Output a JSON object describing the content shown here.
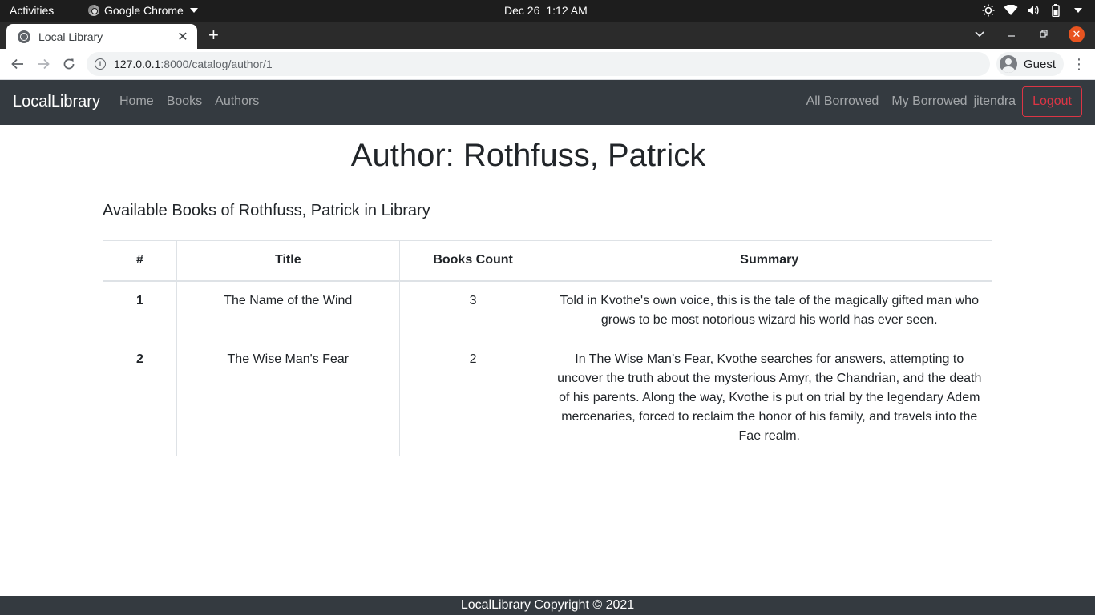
{
  "system_bar": {
    "activities": "Activities",
    "app_name": "Google Chrome",
    "date": "Dec 26",
    "time": "1:12 AM",
    "tray_icons": [
      "brightness-icon",
      "wifi-icon",
      "volume-icon",
      "battery-icon",
      "power-caret-icon"
    ]
  },
  "browser": {
    "tab_title": "Local Library",
    "url_host": "127.0.0.1",
    "url_path": ":8000/catalog/author/1",
    "profile_label": "Guest"
  },
  "site_nav": {
    "brand": "LocalLibrary",
    "links": [
      "Home",
      "Books",
      "Authors"
    ],
    "all_borrowed": "All Borrowed",
    "my_borrowed": "My Borrowed",
    "username": "jitendra",
    "logout": "Logout",
    "colors": {
      "navbar_bg": "#343a40",
      "logout_red": "#dc3545"
    }
  },
  "main": {
    "title": "Author: Rothfuss, Patrick",
    "subheading": "Available Books of Rothfuss, Patrick in Library",
    "table": {
      "headers": [
        "#",
        "Title",
        "Books Count",
        "Summary"
      ],
      "rows": [
        {
          "num": "1",
          "title": "The Name of the Wind",
          "count": "3",
          "summary": "Told in Kvothe's own voice, this is the tale of the magically gifted man who grows to be most notorious wizard his world has ever seen."
        },
        {
          "num": "2",
          "title": "The Wise Man's Fear",
          "count": "2",
          "summary": "In The Wise Man’s Fear, Kvothe searches for answers, attempting to uncover the truth about the mysterious Amyr, the Chandrian, and the death of his parents. Along the way, Kvothe is put on trial by the legendary Adem mercenaries, forced to reclaim the honor of his family, and travels into the Fae realm."
        }
      ]
    }
  },
  "footer": {
    "text": "LocalLibrary Copyright © 2021"
  }
}
